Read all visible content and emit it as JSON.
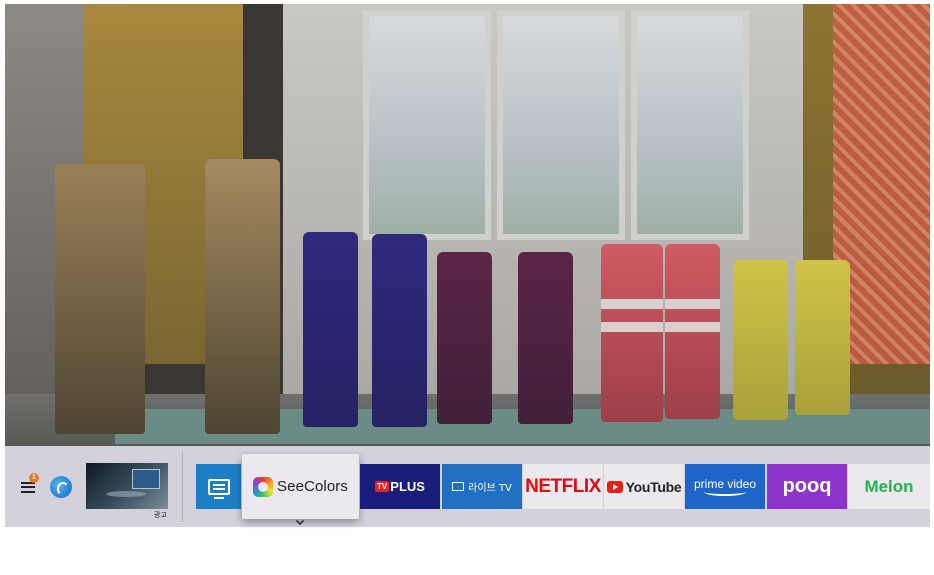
{
  "screen": {
    "background_description_icon": "rain-boots-photo"
  },
  "hub": {
    "menu": {
      "icon": "hamburger-menu-icon",
      "badge": "1"
    },
    "bixby": {
      "icon": "bixby-icon"
    },
    "ambient": {
      "label": "광고"
    },
    "apps": [
      {
        "id": "source",
        "icon": "source-monitor-icon",
        "color": "#1d7ec8"
      },
      {
        "id": "seecolors",
        "label": "SeeColors",
        "focused": true
      },
      {
        "id": "tvplus",
        "badge": "TV",
        "label": "PLUS",
        "color": "#1a1d7a"
      },
      {
        "id": "live",
        "label": "라이브 TV",
        "color": "#2270c4"
      },
      {
        "id": "netflix",
        "label": "NETFLIX",
        "color": "#e50914"
      },
      {
        "id": "youtube",
        "label": "YouTube",
        "color": "#e62117"
      },
      {
        "id": "prime",
        "label": "prime video",
        "color": "#1f64c8"
      },
      {
        "id": "pooq",
        "label": "pooq",
        "color": "#8b35cc"
      },
      {
        "id": "melon",
        "label": "Melon",
        "color": "#1fb54a"
      }
    ]
  }
}
